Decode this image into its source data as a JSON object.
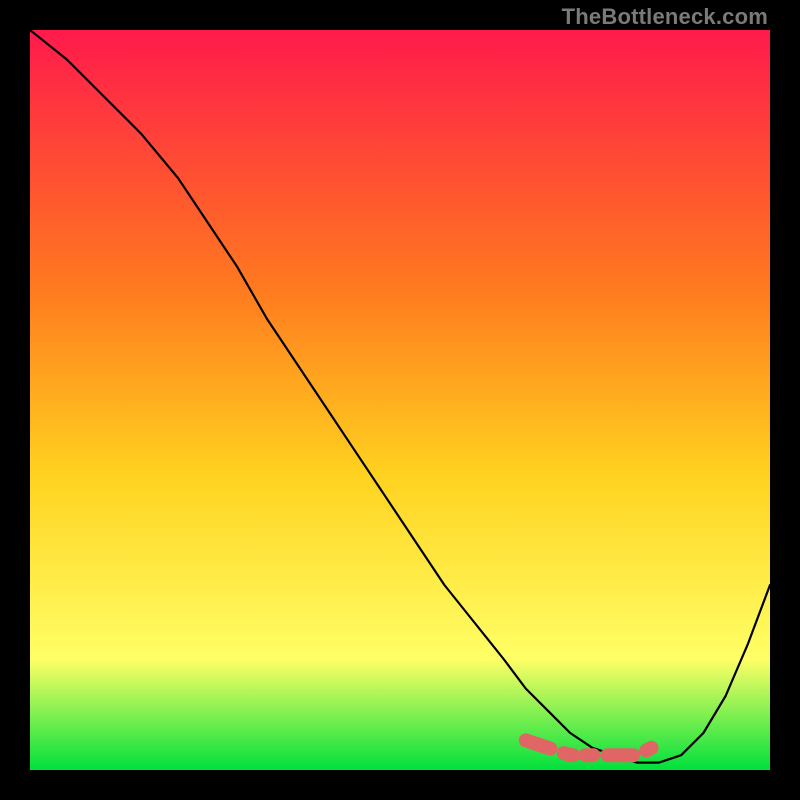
{
  "watermark": "TheBottleneck.com",
  "colors": {
    "gradient_top": "#ff1a4b",
    "gradient_mid1": "#ff7a1f",
    "gradient_mid2": "#ffd21f",
    "gradient_mid3": "#ffff66",
    "gradient_bottom": "#00e03c",
    "curve": "#000000",
    "marker": "#e06666",
    "frame_bg": "#000000"
  },
  "chart_data": {
    "type": "line",
    "title": "",
    "xlabel": "",
    "ylabel": "",
    "xlim": [
      0,
      100
    ],
    "ylim": [
      0,
      100
    ],
    "series": [
      {
        "name": "bottleneck-curve",
        "x": [
          0,
          5,
          10,
          15,
          20,
          24,
          28,
          32,
          36,
          40,
          44,
          48,
          52,
          56,
          60,
          64,
          67,
          70,
          73,
          76,
          79,
          82,
          85,
          88,
          91,
          94,
          97,
          100
        ],
        "y": [
          100,
          96,
          91,
          86,
          80,
          74,
          68,
          61,
          55,
          49,
          43,
          37,
          31,
          25,
          20,
          15,
          11,
          8,
          5,
          3,
          2,
          1,
          1,
          2,
          5,
          10,
          17,
          25
        ]
      }
    ],
    "markers": {
      "name": "highlight-segment",
      "x": [
        67,
        70,
        73,
        76,
        79,
        82,
        84
      ],
      "y": [
        4,
        3,
        2,
        2,
        2,
        2,
        3
      ]
    }
  }
}
